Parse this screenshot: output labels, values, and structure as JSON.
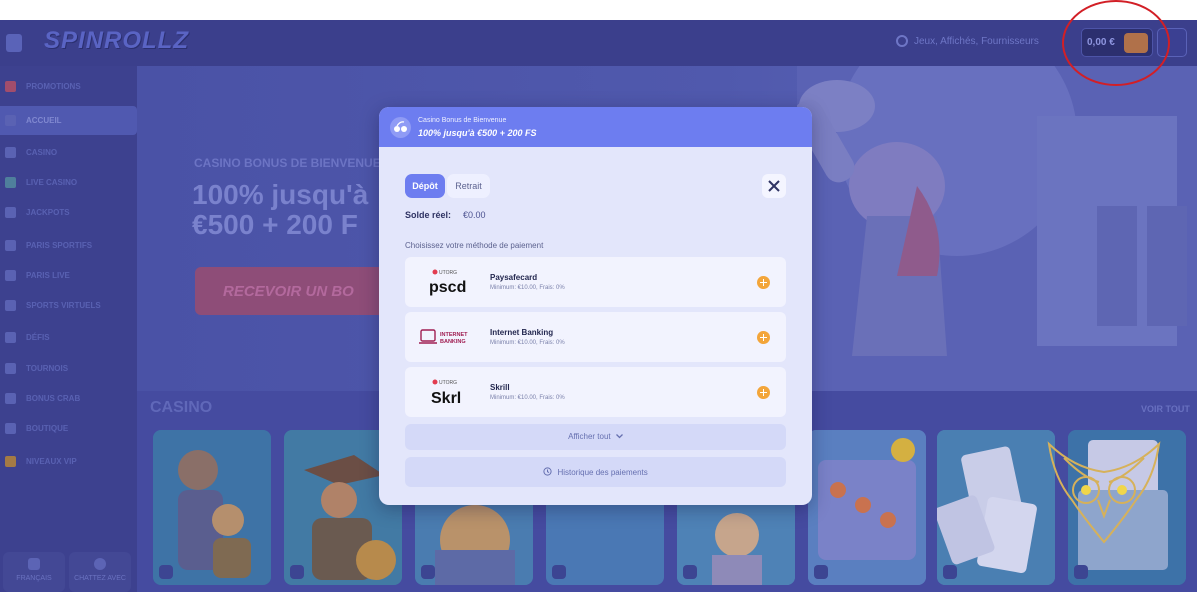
{
  "header": {
    "logo": "SPINROLLZ",
    "search_placeholder": "Jeux, Affichés, Fournisseurs",
    "balance": "0,00 €"
  },
  "sidebar": {
    "items": [
      {
        "label": "PROMOTIONS"
      },
      {
        "label": "ACCUEIL",
        "active": true
      },
      {
        "label": "CASINO"
      },
      {
        "label": "LIVE CASINO"
      },
      {
        "label": "JACKPOTS"
      },
      {
        "label": "PARIS SPORTIFS"
      },
      {
        "label": "PARIS LIVE"
      },
      {
        "label": "SPORTS VIRTUELS"
      },
      {
        "label": "DÉFIS"
      },
      {
        "label": "TOURNOIS"
      },
      {
        "label": "BONUS CRAB"
      },
      {
        "label": "BOUTIQUE"
      },
      {
        "label": "NIVEAUX VIP"
      }
    ],
    "footer": {
      "language": "FRANÇAIS",
      "support": "CHATTEZ AVEC"
    }
  },
  "hero": {
    "subtitle": "CASINO BONUS DE BIENVENUE",
    "line1": "100% jusqu'à",
    "line2": "€500 + 200 F",
    "cta": "RECEVOIR UN BO"
  },
  "casino_section": {
    "heading": "CASINO",
    "view_all": "VOIR TOUT"
  },
  "modal": {
    "kicker": "Casino Bonus de Bienvenue",
    "title": "100% jusqu'à €500 + 200 FS",
    "tabs": {
      "deposit": "Dépôt",
      "withdraw": "Retrait"
    },
    "balance_label": "Solde réel:",
    "balance_value": "€0.00",
    "choose_label": "Choisissez votre méthode de paiement",
    "methods": [
      {
        "name": "Paysafecard",
        "meta": "Minimum: €10.00, Frais: 0%",
        "logo_top": "UTORG",
        "logo_main": "pscd"
      },
      {
        "name": "Internet Banking",
        "meta": "Minimum: €10.00, Frais: 0%",
        "logo_main": "INTERNET BANKING"
      },
      {
        "name": "Skrill",
        "meta": "Minimum: €10.00, Frais: 0%",
        "logo_top": "UTORG",
        "logo_main": "Skrl"
      }
    ],
    "show_all": "Afficher tout",
    "history": "Historique des paiements"
  },
  "colors": {
    "modal_accent": "#6d7df0",
    "add_button": "#f3a53a",
    "highlight_circle": "#d21f26",
    "overlay_tint": "#3b3f8c"
  }
}
